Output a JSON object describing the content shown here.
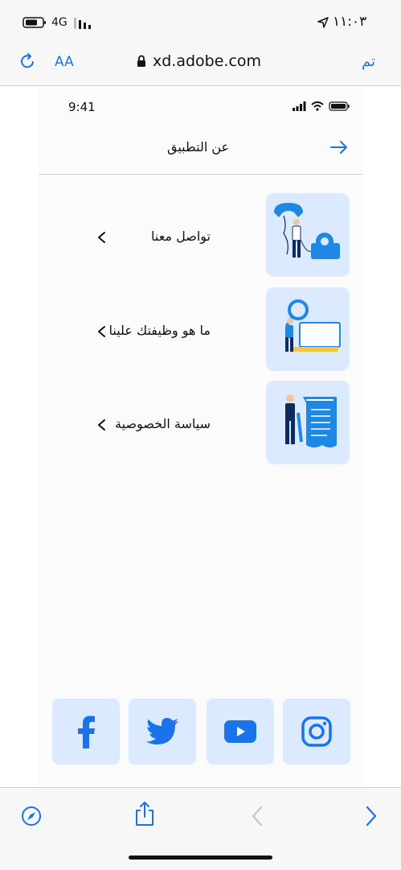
{
  "status_bar": {
    "carrier": "4G",
    "time": "١١:٠٣"
  },
  "browser": {
    "url": "xd.adobe.com",
    "text_size_label": "AA",
    "done_label": "تم"
  },
  "mock_status": {
    "time": "9:41"
  },
  "header": {
    "title": "عن التطبيق"
  },
  "menu": {
    "items": [
      {
        "label": "تواصل معنا",
        "icon": "phone-illustration"
      },
      {
        "label": "ما هو وظيفتك علينا",
        "icon": "search-illustration"
      },
      {
        "label": "سياسة الخصوصية",
        "icon": "document-illustration"
      }
    ]
  },
  "social": {
    "items": [
      "facebook",
      "twitter",
      "youtube",
      "instagram"
    ]
  },
  "colors": {
    "accent": "#1a73e8",
    "card_bg": "#dbeafe",
    "illustration_blue": "#1e88e5",
    "navy": "#0d2b5e"
  }
}
